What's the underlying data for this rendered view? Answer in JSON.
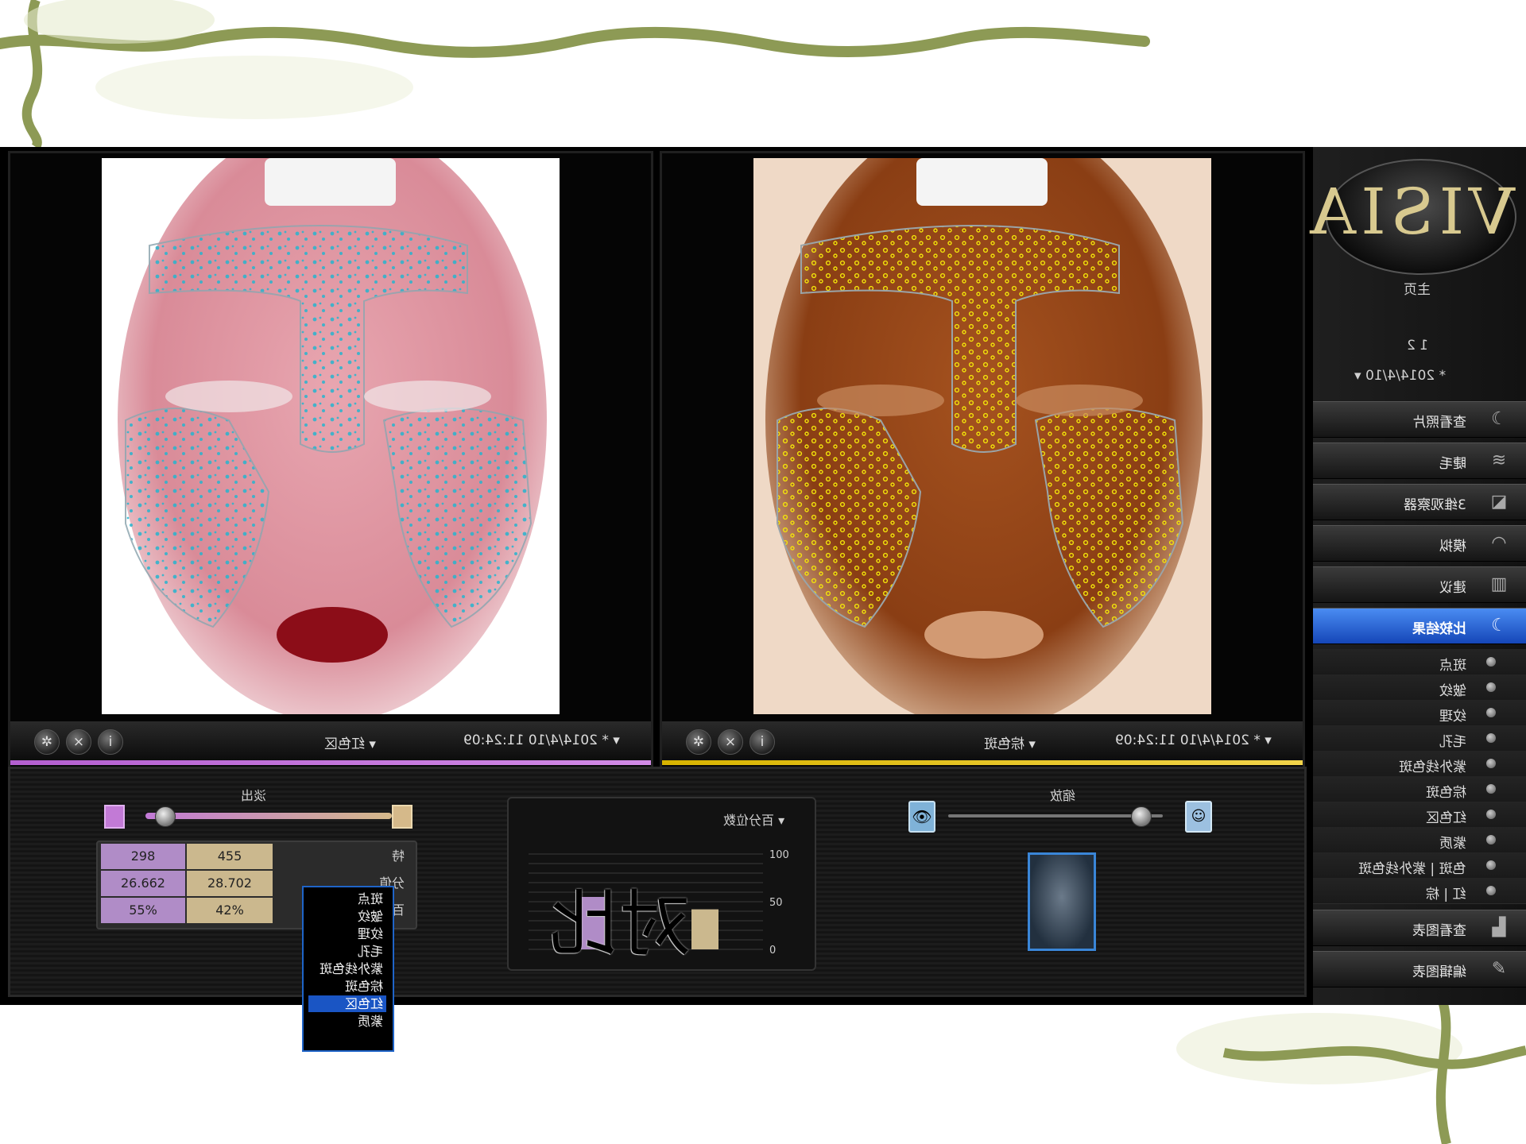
{
  "app": {
    "logo_text": "VISIA",
    "home_label": "主页",
    "patient_id": "1 2",
    "session_date": "* 2014/4/10"
  },
  "sidebar": {
    "buttons": [
      {
        "label": "查看照片",
        "icon": "face-profile-icon"
      },
      {
        "label": "睫毛",
        "icon": "eyelash-icon"
      },
      {
        "label": "3维观察器",
        "icon": "3d-viewer-icon"
      },
      {
        "label": "模拟",
        "icon": "simulation-icon"
      },
      {
        "label": "建议",
        "icon": "advice-icon"
      },
      {
        "label": "比较结果",
        "icon": "compare-results-icon"
      }
    ],
    "items": [
      "斑点",
      "皱纹",
      "纹理",
      "毛孔",
      "紫外线色斑",
      "棕色斑",
      "红色区",
      "紫质",
      "色斑 | 紫外线色斑",
      "红 | 棕"
    ],
    "bottom_buttons": [
      {
        "label": "查看图表",
        "icon": "chart-icon"
      },
      {
        "label": "编辑图表",
        "icon": "edit-chart-icon"
      }
    ]
  },
  "left_panel": {
    "date_label": "* 2014/4/10 11:24:09",
    "feature_label": "红色区"
  },
  "right_panel": {
    "date_label": "* 2014/4/10 11:24:09",
    "feature_label": "棕色斑"
  },
  "dropdown": {
    "items": [
      "斑点",
      "皱纹",
      "纹理",
      "毛孔",
      "紫外线色斑",
      "棕色斑",
      "红色区",
      "紫质"
    ],
    "selected": "红色区"
  },
  "bottom": {
    "fade_label": "淡出",
    "zoom_label": "缩放",
    "percentile_title": "百分位数",
    "stats": {
      "rows": [
        {
          "label": "特",
          "purple": "298",
          "tan": "455"
        },
        {
          "label": "分值",
          "purple": "26.662",
          "tan": "28.702"
        },
        {
          "label": "百分位数",
          "purple": "55%",
          "tan": "42%"
        }
      ]
    }
  },
  "overlay_text": "对比",
  "colors": {
    "left_accent": "#b45fd0",
    "right_accent": "#d8b400",
    "active_blue": "#1a55c4",
    "purple_bar": "#b08cc7",
    "tan_bar": "#cbb88e"
  },
  "chart_data": {
    "type": "bar",
    "categories": [
      "left",
      "right"
    ],
    "values": [
      55,
      42
    ],
    "ylim": [
      0,
      100
    ],
    "yticks": [
      "0",
      "50",
      "100"
    ]
  }
}
